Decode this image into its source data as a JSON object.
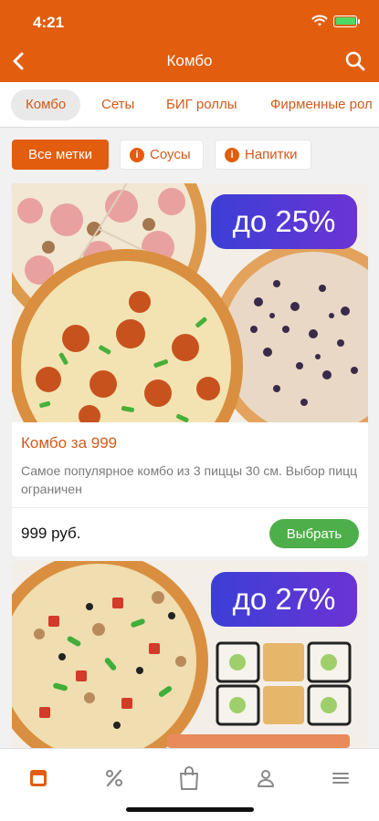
{
  "status": {
    "time": "4:21"
  },
  "nav": {
    "title": "Комбо"
  },
  "tabs": [
    {
      "label": "Комбо",
      "active": true
    },
    {
      "label": "Сеты",
      "active": false
    },
    {
      "label": "БИГ роллы",
      "active": false
    },
    {
      "label": "Фирменные рол",
      "active": false
    }
  ],
  "filters": [
    {
      "label": "Все метки",
      "selected": true,
      "icon": ""
    },
    {
      "label": "Соусы",
      "selected": false,
      "icon": "info-icon"
    },
    {
      "label": "Напитки",
      "selected": false,
      "icon": "info-icon"
    }
  ],
  "filter_icon_glyph": "i",
  "products": [
    {
      "promo": "до 25%",
      "title": "Комбо за 999",
      "description": "Самое популярное комбо из 3 пиццы 30 см. Выбор пицц ограничен",
      "price": "999 руб.",
      "button": "Выбрать"
    },
    {
      "promo": "до 27%"
    }
  ],
  "bottom_nav": [
    "menu-icon-active",
    "percent-icon",
    "bag-icon",
    "profile-icon",
    "hamburger-icon"
  ],
  "colors": {
    "brand": "#e25d0e",
    "accent_text": "#d25a1a",
    "promo_start": "#3b3fd6",
    "promo_end": "#6c33d4",
    "button": "#4daf4a"
  }
}
